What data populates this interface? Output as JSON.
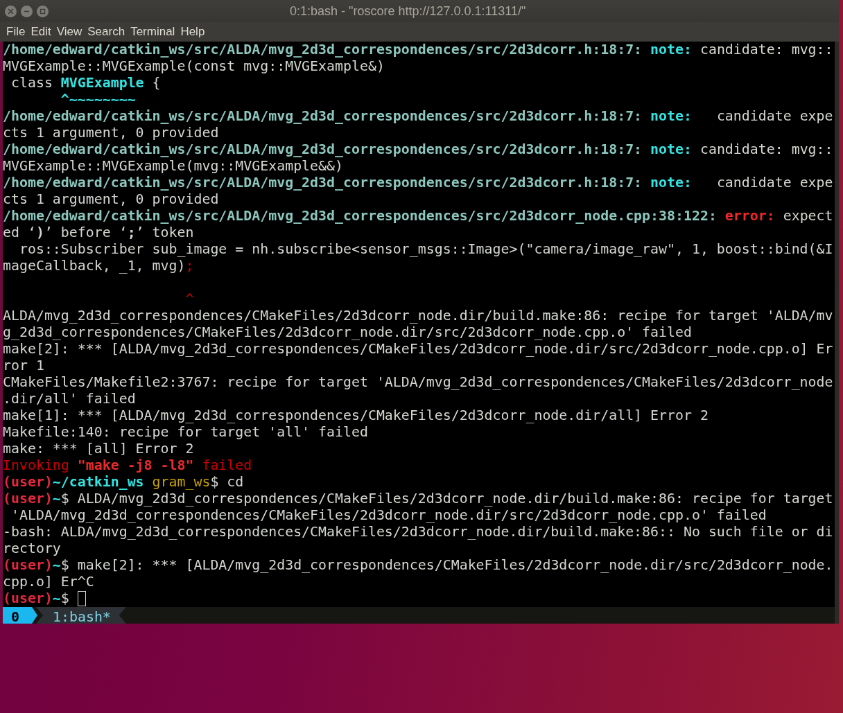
{
  "window": {
    "title": "0:1:bash - \"roscore http://127.0.0.1:11311/\""
  },
  "menu": [
    "File",
    "Edit",
    "View",
    "Search",
    "Terminal",
    "Help"
  ],
  "terminal_lines": [
    {
      "kind": "text",
      "segments": [
        {
          "kind": "path",
          "text": "/home/edward/catkin_ws/src/ALDA/mvg_2d3d_correspondences/src/2d3dcorr.h:18:7:"
        },
        {
          "kind": "note",
          "text": " note:"
        },
        {
          "kind": "plain",
          "text": " candidate: mvg::"
        }
      ]
    },
    {
      "kind": "text",
      "segments": [
        {
          "kind": "plain",
          "text": "MVGExample::MVGExample(const mvg::MVGExample&)"
        }
      ]
    },
    {
      "kind": "text",
      "segments": [
        {
          "kind": "plain",
          "text": " class "
        },
        {
          "kind": "note",
          "text": "MVGExample"
        },
        {
          "kind": "plain",
          "text": " {"
        }
      ]
    },
    {
      "kind": "text",
      "segments": [
        {
          "kind": "note",
          "text": "       ^~~~~~~~~"
        }
      ]
    },
    {
      "kind": "text",
      "segments": [
        {
          "kind": "path",
          "text": "/home/edward/catkin_ws/src/ALDA/mvg_2d3d_correspondences/src/2d3dcorr.h:18:7:"
        },
        {
          "kind": "note",
          "text": " note:"
        },
        {
          "kind": "plain",
          "text": "   candidate expe"
        }
      ]
    },
    {
      "kind": "text",
      "segments": [
        {
          "kind": "plain",
          "text": "cts 1 argument, 0 provided"
        }
      ]
    },
    {
      "kind": "text",
      "segments": [
        {
          "kind": "path",
          "text": "/home/edward/catkin_ws/src/ALDA/mvg_2d3d_correspondences/src/2d3dcorr.h:18:7:"
        },
        {
          "kind": "note",
          "text": " note:"
        },
        {
          "kind": "plain",
          "text": " candidate: mvg::"
        }
      ]
    },
    {
      "kind": "text",
      "segments": [
        {
          "kind": "plain",
          "text": "MVGExample::MVGExample(mvg::MVGExample&&)"
        }
      ]
    },
    {
      "kind": "text",
      "segments": [
        {
          "kind": "path",
          "text": "/home/edward/catkin_ws/src/ALDA/mvg_2d3d_correspondences/src/2d3dcorr.h:18:7:"
        },
        {
          "kind": "note",
          "text": " note:"
        },
        {
          "kind": "plain",
          "text": "   candidate expe"
        }
      ]
    },
    {
      "kind": "text",
      "segments": [
        {
          "kind": "plain",
          "text": "cts 1 argument, 0 provided"
        }
      ]
    },
    {
      "kind": "text",
      "segments": [
        {
          "kind": "path",
          "text": "/home/edward/catkin_ws/src/ALDA/mvg_2d3d_correspondences/src/2d3dcorr_node.cpp:38:122:"
        },
        {
          "kind": "error",
          "text": " error:"
        },
        {
          "kind": "plain",
          "text": " expect"
        }
      ]
    },
    {
      "kind": "text",
      "segments": [
        {
          "kind": "plain",
          "text": "ed ‘"
        },
        {
          "kind": "bold",
          "text": ")"
        },
        {
          "kind": "plain",
          "text": "’ before ‘"
        },
        {
          "kind": "bold",
          "text": ";"
        },
        {
          "kind": "plain",
          "text": "’ token"
        }
      ]
    },
    {
      "kind": "text",
      "segments": [
        {
          "kind": "plain",
          "text": "  ros::Subscriber sub_image = nh.subscribe<sensor_msgs::Image>(\"camera/image_raw\", 1, boost::bind(&I"
        }
      ]
    },
    {
      "kind": "text",
      "segments": [
        {
          "kind": "plain",
          "text": "mageCallback, _1, mvg)"
        },
        {
          "kind": "red",
          "text": ";"
        }
      ]
    },
    {
      "kind": "blank"
    },
    {
      "kind": "text",
      "segments": [
        {
          "kind": "red",
          "text": "                      ^"
        }
      ]
    },
    {
      "kind": "text",
      "segments": [
        {
          "kind": "plain",
          "text": "ALDA/mvg_2d3d_correspondences/CMakeFiles/2d3dcorr_node.dir/build.make:86: recipe for target 'ALDA/mv"
        }
      ]
    },
    {
      "kind": "text",
      "segments": [
        {
          "kind": "plain",
          "text": "g_2d3d_correspondences/CMakeFiles/2d3dcorr_node.dir/src/2d3dcorr_node.cpp.o' failed"
        }
      ]
    },
    {
      "kind": "text",
      "segments": [
        {
          "kind": "plain",
          "text": "make[2]: *** [ALDA/mvg_2d3d_correspondences/CMakeFiles/2d3dcorr_node.dir/src/2d3dcorr_node.cpp.o] Er"
        }
      ]
    },
    {
      "kind": "text",
      "segments": [
        {
          "kind": "plain",
          "text": "ror 1"
        }
      ]
    },
    {
      "kind": "text",
      "segments": [
        {
          "kind": "plain",
          "text": "CMakeFiles/Makefile2:3767: recipe for target 'ALDA/mvg_2d3d_correspondences/CMakeFiles/2d3dcorr_node"
        }
      ]
    },
    {
      "kind": "text",
      "segments": [
        {
          "kind": "plain",
          "text": ".dir/all' failed"
        }
      ]
    },
    {
      "kind": "text",
      "segments": [
        {
          "kind": "plain",
          "text": "make[1]: *** [ALDA/mvg_2d3d_correspondences/CMakeFiles/2d3dcorr_node.dir/all] Error 2"
        }
      ]
    },
    {
      "kind": "text",
      "segments": [
        {
          "kind": "plain",
          "text": "Makefile:140: recipe for target 'all' failed"
        }
      ]
    },
    {
      "kind": "text",
      "segments": [
        {
          "kind": "plain",
          "text": "make: *** [all] Error 2"
        }
      ]
    },
    {
      "kind": "text",
      "segments": [
        {
          "kind": "red",
          "text": "Invoking "
        },
        {
          "kind": "redbold",
          "text": "\"make -j8 -l8\""
        },
        {
          "kind": "red",
          "text": " failed"
        }
      ]
    },
    {
      "kind": "text",
      "segments": [
        {
          "kind": "user",
          "text": "(user)"
        },
        {
          "kind": "cwd",
          "text": "~/catkin_ws"
        },
        {
          "kind": "yellow",
          "text": " gram_ws"
        },
        {
          "kind": "plain",
          "text": "$ cd"
        }
      ]
    },
    {
      "kind": "text",
      "segments": [
        {
          "kind": "user",
          "text": "(user)"
        },
        {
          "kind": "cwd",
          "text": "~"
        },
        {
          "kind": "plain",
          "text": "$ ALDA/mvg_2d3d_correspondences/CMakeFiles/2d3dcorr_node.dir/build.make:86: recipe for target"
        }
      ]
    },
    {
      "kind": "text",
      "segments": [
        {
          "kind": "plain",
          "text": " 'ALDA/mvg_2d3d_correspondences/CMakeFiles/2d3dcorr_node.dir/src/2d3dcorr_node.cpp.o' failed"
        }
      ]
    },
    {
      "kind": "text",
      "segments": [
        {
          "kind": "plain",
          "text": "-bash: ALDA/mvg_2d3d_correspondences/CMakeFiles/2d3dcorr_node.dir/build.make:86:: No such file or di"
        }
      ]
    },
    {
      "kind": "text",
      "segments": [
        {
          "kind": "plain",
          "text": "rectory"
        }
      ]
    },
    {
      "kind": "text",
      "segments": [
        {
          "kind": "user",
          "text": "(user)"
        },
        {
          "kind": "cwd",
          "text": "~"
        },
        {
          "kind": "plain",
          "text": "$ make[2]: *** [ALDA/mvg_2d3d_correspondences/CMakeFiles/2d3dcorr_node.dir/src/2d3dcorr_node."
        }
      ]
    },
    {
      "kind": "text",
      "segments": [
        {
          "kind": "plain",
          "text": "cpp.o] Er^C"
        }
      ]
    },
    {
      "kind": "text",
      "segments": [
        {
          "kind": "user",
          "text": "(user)"
        },
        {
          "kind": "cwd",
          "text": "~"
        },
        {
          "kind": "plain",
          "text": "$ "
        }
      ],
      "cursor": true
    }
  ],
  "tmux_status": {
    "session": "0",
    "windows": [
      {
        "label": "1:bash*",
        "selected": true
      }
    ]
  }
}
